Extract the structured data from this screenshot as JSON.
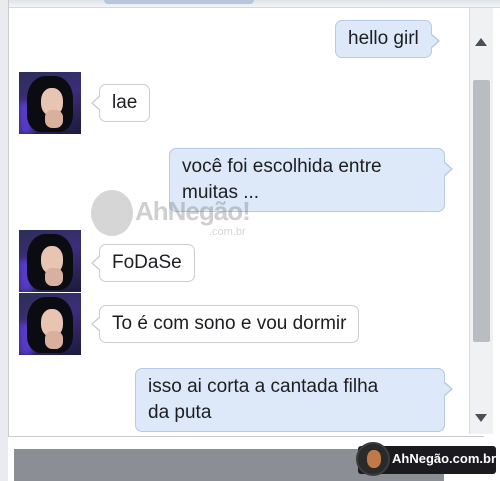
{
  "conversation": {
    "messages": [
      {
        "side": "out",
        "text": "hello girl"
      },
      {
        "side": "in",
        "text": "lae"
      },
      {
        "side": "out",
        "lines": [
          "você foi escolhida entre",
          "muitas ..."
        ]
      },
      {
        "side": "in",
        "text": "FoDaSe"
      },
      {
        "side": "in",
        "text": "To é com sono e vou dormir"
      },
      {
        "side": "out",
        "lines": [
          "isso ai corta a cantada filha",
          "da puta"
        ]
      }
    ]
  },
  "watermark": {
    "name": "AhNegão!",
    "sub": ".com.br"
  },
  "badge": {
    "text": "AhNegão.com.br"
  },
  "colors": {
    "outgoing_bubble": "#dde9f8",
    "incoming_bubble": "#ffffff",
    "scrollbar_thumb": "#b9bcc1"
  }
}
